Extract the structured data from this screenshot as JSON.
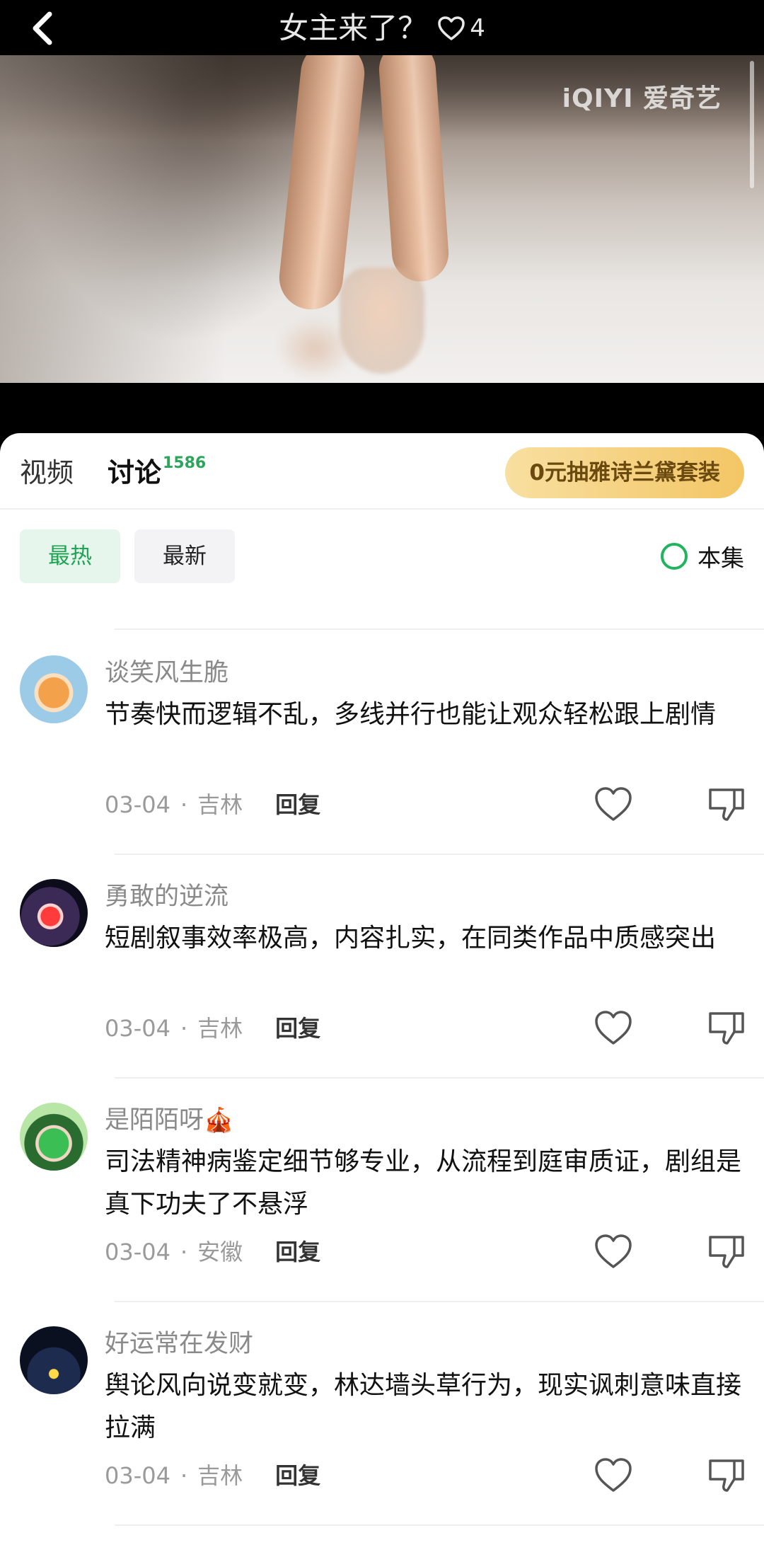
{
  "header": {
    "title": "女主来了？",
    "like_count": "4"
  },
  "video": {
    "watermark": "iQIYI 爱奇艺"
  },
  "tabs": {
    "video_label": "视频",
    "discuss_label": "讨论",
    "discuss_count": "1586"
  },
  "promo": {
    "label": "0元抽雅诗兰黛套装"
  },
  "filters": {
    "hot_label": "最热",
    "new_label": "最新",
    "episode_label": "本集"
  },
  "comments": [
    {
      "username": "谈笑风生脆",
      "text": "节奏快而逻辑不乱，多线并行也能让观众轻松跟上剧情",
      "date": "03-04",
      "location": "吉林",
      "reply_label": "回复"
    },
    {
      "username": "勇敢的逆流",
      "text": "短剧叙事效率极高，内容扎实，在同类作品中质感突出",
      "date": "03-04",
      "location": "吉林",
      "reply_label": "回复"
    },
    {
      "username": "是陌陌呀",
      "username_emoji": "🎪",
      "text": "司法精神病鉴定细节够专业，从流程到庭审质证，剧组是真下功夫了不悬浮",
      "date": "03-04",
      "location": "安徽",
      "reply_label": "回复"
    },
    {
      "username": "好运常在发财",
      "text": "舆论风向说变就变，林达墙头草行为，现实讽刺意味直接拉满",
      "date": "03-04",
      "location": "吉林",
      "reply_label": "回复"
    }
  ],
  "meta_separator": "·",
  "colors": {
    "accent_green": "#22b35e",
    "promo_gold": "#f3c665"
  }
}
